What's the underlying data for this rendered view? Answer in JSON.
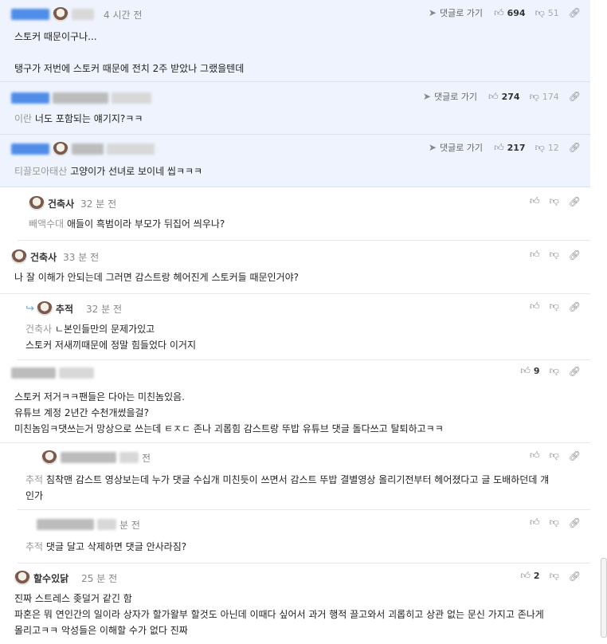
{
  "comments": [
    {
      "time": "4 시간 전",
      "goto": "댓글로 가기",
      "likes": "694",
      "dislikes": "51",
      "lines": [
        "스토커 때문이구나...",
        "",
        "탱구가 저번에 스토커 때문에 전치 2주 받았나 그랬을텐데"
      ]
    },
    {
      "time": "",
      "goto": "댓글로 가기",
      "likes": "274",
      "dislikes": "174",
      "quote": "이란",
      "text": "너도 포함되는 얘기지?ㅋㅋ"
    },
    {
      "time": "",
      "goto": "댓글로 가기",
      "likes": "217",
      "dislikes": "12",
      "quote": "티끌모아태산",
      "text": "고양이가 선녀로 보이네 씹ㅋㅋㅋ"
    },
    {
      "name": "건축사",
      "time": "32 분 전",
      "quote": "빼액수대",
      "text": "애들이 흑범이라 부모가 뒤집어 씌우나?"
    },
    {
      "name": "건축사",
      "time": "33 분 전",
      "text": "나 잘 이해가 안되는데 그러면 감스트랑 헤어진게 스토커들 때문인거야?"
    },
    {
      "name": "추적",
      "time": "32 분 전",
      "quote": "건축사",
      "text": "ㄴ본인들만의 문제가있고",
      "text2": "스토커 저새끼때문에 정말 힘들었다 이거지"
    },
    {
      "likes": "9",
      "lines": [
        "스토커 저거ㅋㅋ팬들은 다아는 미친놈있음.",
        "유튜브 계정 2년간 수천개썼을걸?",
        "미친놈임ㅋ댓쓰는거 망상으로 쓰는데 ㅌㅈㄷ 존나 괴롭힘 감스트랑 뚜밥 유튜브 댓글 돌다쓰고 탈퇴하고ㅋㅋ"
      ]
    },
    {
      "time": "전",
      "quote": "추적",
      "text": "침착맨 감스트 영상보는데 누가 댓글 수십개 미친듯이 쓰면서 감스트 뚜밥 결별영상 올리기전부터 헤어졌다고 글 도배하던데 걔",
      "text2": "인가"
    },
    {
      "time": "분 전",
      "quote": "추적",
      "text": "댓글 달고 삭제하면 댓글 안사라짐?"
    },
    {
      "name": "할수있닭",
      "time": "25 분 전",
      "likes": "2",
      "lines": [
        "진짜 스트레스 좆덜거 같긴 함",
        "파혼은 뭐 연인간의 일이라 상자가 할가왈부 할것도 아닌데 이때다 싶어서 과거 행적 끌고와서 괴롭히고 상관 없는 문신 가지고 존나게",
        "몰리고ㅋㅋ 악성들은 이해할 수가 없다 진짜"
      ]
    }
  ],
  "icons": {
    "thumb_up": "thumbs-up-icon",
    "thumb_down": "thumbs-down-icon",
    "link": "link-icon",
    "reply_arrow": "reply-arrow-icon",
    "goto": "send-icon"
  }
}
